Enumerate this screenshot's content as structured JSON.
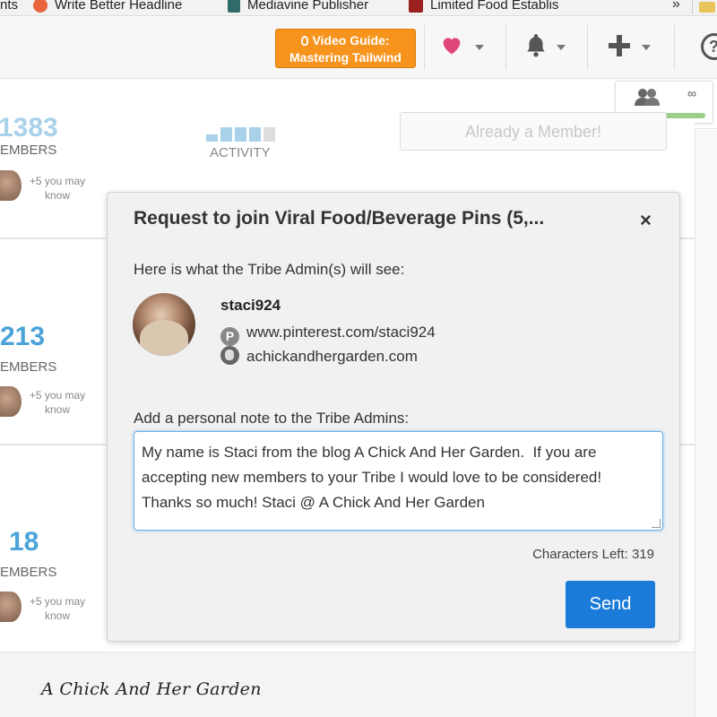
{
  "bookmarks": [
    {
      "label": "nts",
      "icon": "bookmark-fragment"
    },
    {
      "label": "Write Better Headline",
      "icon": "co-schedule-icon"
    },
    {
      "label": "Mediavine Publisher",
      "icon": "mediavine-icon"
    },
    {
      "label": "Limited Food Establis",
      "icon": "pa-icon"
    }
  ],
  "bookmarks_more": "»",
  "toolbar": {
    "video_guide_line1": "Video Guide:",
    "video_guide_line2": "Mastering Tailwind",
    "help_label": "?"
  },
  "member_widget": {
    "limit": "∞"
  },
  "list": {
    "cards": [
      {
        "count": "1383",
        "label": "EMBERS",
        "know": "+5 you may know",
        "activity_label": "ACTIVITY",
        "action": "Already a Member!"
      },
      {
        "count": "213",
        "label": "EMBERS",
        "know": "+5 you may know"
      },
      {
        "count": "18",
        "label": "EMBERS",
        "know": "+5 you may know"
      }
    ]
  },
  "modal": {
    "title": "Request to join Viral Food/Beverage Pins (5,...",
    "close": "×",
    "intro": "Here is what the Tribe Admin(s) will see:",
    "username": "staci924",
    "pinterest_url": "www.pinterest.com/staci924",
    "website": "achickandhergarden.com",
    "pinterest_glyph": "P",
    "note_label": "Add a personal note to the Tribe Admins:",
    "note_value": "My name is Staci from the blog A Chick And Her Garden.  If you are accepting new members to your Tribe I would love to be considered!  Thanks so much! Staci @ A Chick And Her Garden",
    "chars_left": "Characters Left: 319",
    "send_label": "Send"
  },
  "watermark": "A Chick And Her Garden",
  "colors": {
    "accent_orange": "#f7941d",
    "send_blue": "#1a7bd8",
    "count_blue": "#4aa3d9",
    "heart_pink": "#e0457b"
  }
}
